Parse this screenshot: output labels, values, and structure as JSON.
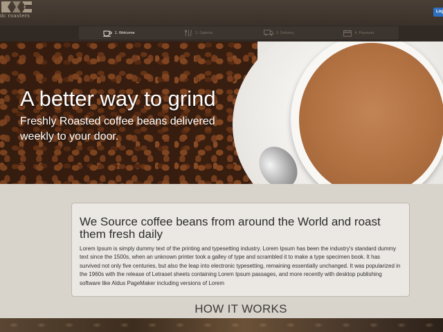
{
  "header": {
    "logo_text": "dc roasters",
    "login_label": "Login"
  },
  "steps": [
    {
      "label": "1. Welcome",
      "icon": "coffee-cup-icon",
      "active": true
    },
    {
      "label": "2. Options",
      "icon": "utensils-icon",
      "active": false
    },
    {
      "label": "3. Delivery",
      "icon": "truck-icon",
      "active": false
    },
    {
      "label": "4. Payment",
      "icon": "credit-card-icon",
      "active": false
    }
  ],
  "hero": {
    "title": "A better way to grind",
    "subtitle": "Freshly Roasted coffee beans delivered weekly to your door."
  },
  "about": {
    "heading": "We Source coffee beans from around the World and roast them fresh daily",
    "body": "Lorem Ipsum is simply dummy text of the printing and typesetting industry. Lorem Ipsum has been the industry's standard dummy text since the 1500s, when an unknown printer took a galley of type and scrambled it to make a type specimen book. It has survived not only five centuries, but also the leap into electronic typesetting, remaining essentially unchanged. It was popularized in the 1960s with the release of Letraset sheets containing Lorem Ipsum passages, and more recently with desktop publishing software like Aldus PageMaker including versions of Lorem"
  },
  "how_it_works": {
    "title": "HOW IT WORKS"
  },
  "colors": {
    "header_bg": "#3a312a",
    "accent_blue": "#2f6fc0",
    "page_bg": "#d9d4cb"
  }
}
